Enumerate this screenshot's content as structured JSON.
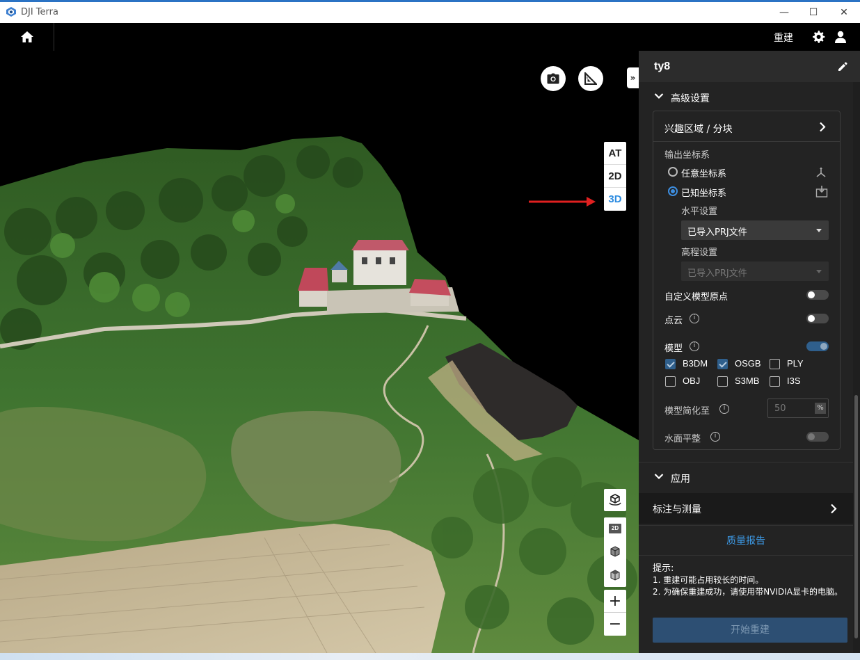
{
  "window": {
    "title": "DJI Terra",
    "minimize": "—",
    "maximize": "☐",
    "close": "✕"
  },
  "topbar": {
    "rebuild_label": "重建"
  },
  "viewer": {
    "collapse_symbol": "»",
    "modes": [
      "AT",
      "2D",
      "3D"
    ],
    "active_mode": "3D",
    "tool_2d_label": "2D",
    "zoom_in": "+",
    "zoom_out": "−"
  },
  "panel": {
    "project_name": "ty8",
    "advanced": {
      "title": "高级设置",
      "roi_label": "兴趣区域 / 分块",
      "output_crs_label": "输出坐标系",
      "crs_arbitrary": "任意坐标系",
      "crs_known": "已知坐标系",
      "crs_selected": "known",
      "horizontal_label": "水平设置",
      "horizontal_value": "已导入PRJ文件",
      "vertical_label": "高程设置",
      "vertical_value": "已导入PRJ文件",
      "custom_origin_label": "自定义模型原点",
      "custom_origin_on": false,
      "point_cloud_label": "点云",
      "point_cloud_on": false,
      "model_label": "模型",
      "model_on": true,
      "formats": [
        {
          "label": "B3DM",
          "checked": true
        },
        {
          "label": "OSGB",
          "checked": true
        },
        {
          "label": "PLY",
          "checked": false
        },
        {
          "label": "OBJ",
          "checked": false
        },
        {
          "label": "S3MB",
          "checked": false
        },
        {
          "label": "I3S",
          "checked": false
        }
      ],
      "simplify_label": "模型简化至",
      "simplify_value": "50",
      "simplify_unit": "%",
      "water_flatten_label": "水面平整",
      "water_flatten_on": false
    },
    "apply_label": "应用",
    "annotation_label": "标注与测量",
    "quality_report_label": "质量报告",
    "tips": {
      "title": "提示:",
      "line1": "1. 重建可能占用较长的时间。",
      "line2": "2. 为确保重建成功，请使用带NVIDIA显卡的电脑。"
    },
    "start_button": "开始重建"
  },
  "colors": {
    "accent": "#3d8ee0",
    "panel_bg": "#232323",
    "link": "#3d9be8",
    "annotation_arrow": "#e02020"
  }
}
